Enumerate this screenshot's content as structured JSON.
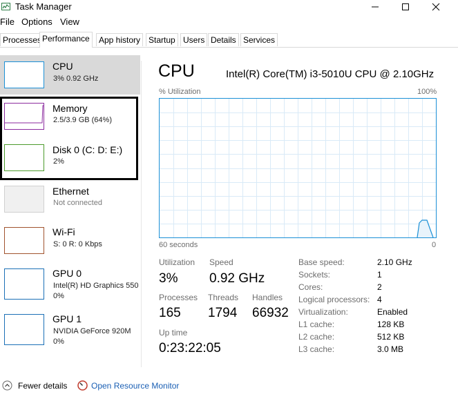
{
  "window": {
    "title": "Task Manager"
  },
  "menu": {
    "file": "File",
    "options": "Options",
    "view": "View"
  },
  "tabs": [
    "Processes",
    "Performance",
    "App history",
    "Startup",
    "Users",
    "Details",
    "Services"
  ],
  "active_tab": "Performance",
  "sidebar": {
    "items": [
      {
        "title": "CPU",
        "sub": "3% 0.92 GHz",
        "color": "#1a8fd6"
      },
      {
        "title": "Memory",
        "sub": "2.5/3.9 GB (64%)",
        "color": "#8b2a9e"
      },
      {
        "title": "Disk 0 (C: D: E:)",
        "sub": "2%",
        "color": "#4b9a2a"
      },
      {
        "title": "Ethernet",
        "sub": "Not connected",
        "color": "#bdbdbd"
      },
      {
        "title": "Wi-Fi",
        "sub": "S: 0 R: 0 Kbps",
        "color": "#a0522d"
      },
      {
        "title": "GPU 0",
        "sub": "Intel(R) HD Graphics 550",
        "sub2": "0%",
        "color": "#1a6fb6"
      },
      {
        "title": "GPU 1",
        "sub": "NVIDIA GeForce 920M",
        "sub2": "0%",
        "color": "#1a6fb6"
      }
    ]
  },
  "main": {
    "title": "CPU",
    "model": "Intel(R) Core(TM) i3-5010U CPU @ 2.10GHz",
    "graph_label_top_left": "% Utilization",
    "graph_label_top_right": "100%",
    "graph_label_bottom_left": "60 seconds",
    "graph_label_bottom_right": "0",
    "utilization_label": "Utilization",
    "utilization": "3%",
    "speed_label": "Speed",
    "speed": "0.92 GHz",
    "processes_label": "Processes",
    "processes": "165",
    "threads_label": "Threads",
    "threads": "1794",
    "handles_label": "Handles",
    "handles": "66932",
    "uptime_label": "Up time",
    "uptime": "0:23:22:05",
    "specs": [
      {
        "k": "Base speed:",
        "v": "2.10 GHz"
      },
      {
        "k": "Sockets:",
        "v": "1"
      },
      {
        "k": "Cores:",
        "v": "2"
      },
      {
        "k": "Logical processors:",
        "v": "4"
      },
      {
        "k": "Virtualization:",
        "v": "Enabled"
      },
      {
        "k": "L1 cache:",
        "v": "128 KB"
      },
      {
        "k": "L2 cache:",
        "v": "512 KB"
      },
      {
        "k": "L3 cache:",
        "v": "3.0 MB"
      }
    ]
  },
  "footer": {
    "fewer_details": "Fewer details",
    "open_monitor": "Open Resource Monitor"
  },
  "colors": {
    "cpu_accent": "#1a8fd6",
    "link": "#1a5fb4"
  }
}
